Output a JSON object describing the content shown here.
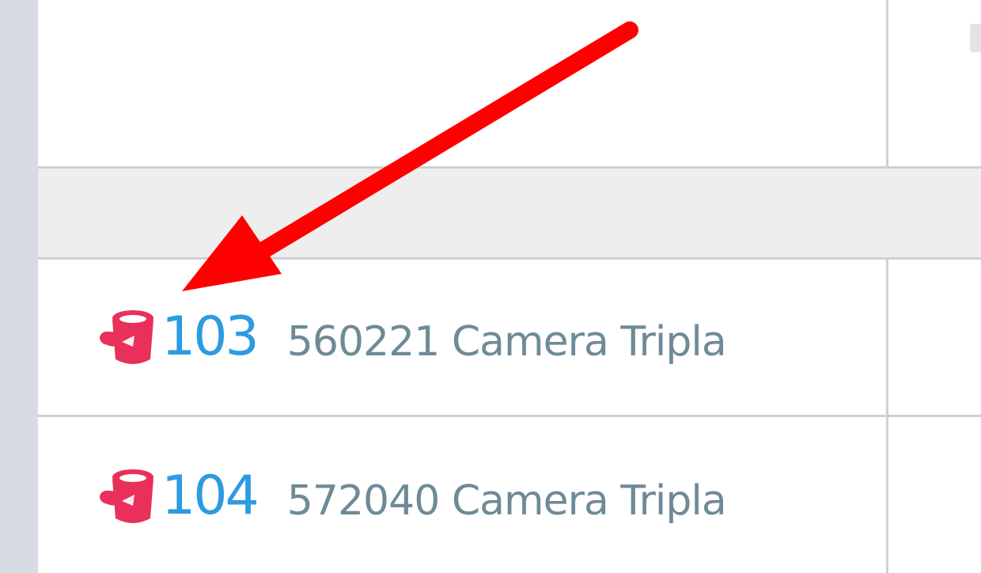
{
  "rooms": [
    {
      "number": "103",
      "description": "560221 Camera Tripla",
      "icon": "paint-bucket-icon"
    },
    {
      "number": "104",
      "description": "572040 Camera Tripla",
      "icon": "paint-bucket-icon"
    }
  ],
  "colors": {
    "room_number": "#2d9be0",
    "room_description": "#6e8a96",
    "icon": "#e8305a",
    "annotation_arrow": "#ff0000",
    "grid_line": "#cfd0d2",
    "group_row": "#eeeeee"
  }
}
